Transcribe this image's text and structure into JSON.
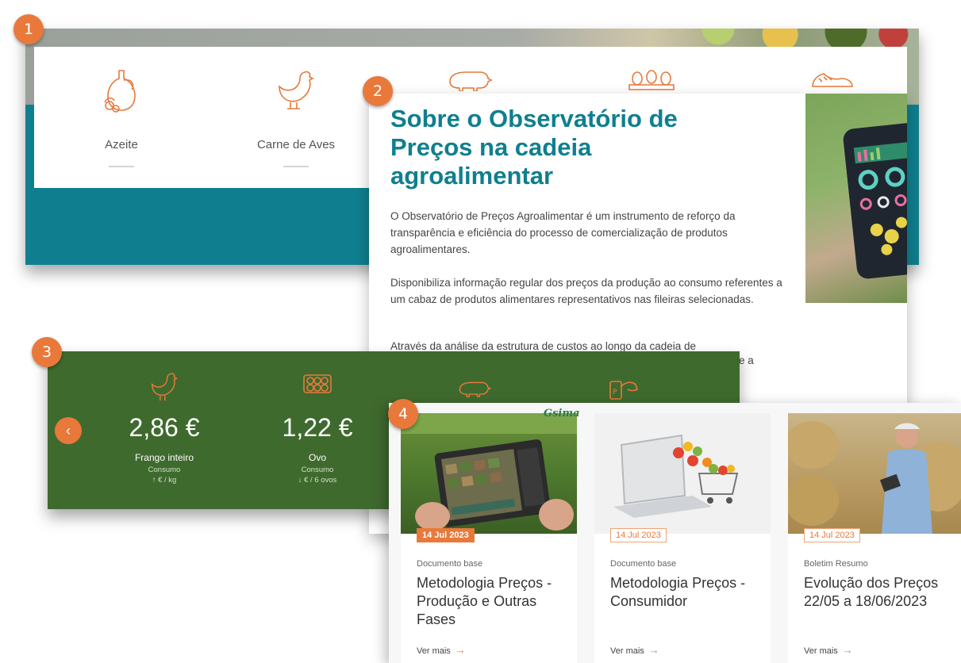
{
  "colors": {
    "accent": "#e8793a",
    "teal": "#0f7f8f",
    "green": "#3f6a2e"
  },
  "badges": [
    "1",
    "2",
    "3",
    "4"
  ],
  "categories": [
    {
      "label": "Azeite",
      "icon": "olive-oil-icon"
    },
    {
      "label": "Carne de Aves",
      "icon": "chicken-icon"
    },
    {
      "label": "",
      "icon": "pig-icon"
    },
    {
      "label": "",
      "icon": "eggs-icon"
    },
    {
      "label": "",
      "icon": "shoes-icon"
    }
  ],
  "about": {
    "title": "Sobre o Observatório de Preços na cadeia agroalimentar",
    "paragraphs": [
      "O Observatório de Preços Agroalimentar é um instrumento de reforço da transparência e eficiência do processo de comercialização de produtos agroalimentares.",
      "Disponibiliza informação regular dos preços da produção ao consumo referentes a um cabaz de produtos alimentares representativos nas fileiras selecionadas.",
      "Através da análise da estrutura de custos ao longo da cadeia de"
    ],
    "para3_tail": "e a"
  },
  "prices": {
    "prev_icon": "‹",
    "items": [
      {
        "icon": "chicken-icon",
        "price": "2,86 €",
        "name": "Frango inteiro",
        "type": "Consumo",
        "unit": "↑ € / kg"
      },
      {
        "icon": "eggs-tray-icon",
        "price": "1,22 €",
        "name": "Ovo",
        "type": "Consumo",
        "unit": "↓ € / 6 ovos"
      },
      {
        "icon": "pig-icon"
      },
      {
        "icon": "dairy-cow-icon"
      }
    ]
  },
  "documents": {
    "logo": "Gsima",
    "items": [
      {
        "date": "14 Jul 2023",
        "type": "Documento base",
        "title": "Metodologia Preços - Produção e Outras Fases",
        "more": "Ver mais",
        "arrow": "→"
      },
      {
        "date": "14 Jul 2023",
        "type": "Documento base",
        "title": "Metodologia Preços - Consumidor",
        "more": "Ver mais",
        "arrow": "→"
      },
      {
        "date": "14 Jul 2023",
        "type": "Boletim Resumo",
        "title": "Evolução dos Preços 22/05 a 18/06/2023",
        "more": "Ver mais",
        "arrow": "→"
      }
    ]
  }
}
